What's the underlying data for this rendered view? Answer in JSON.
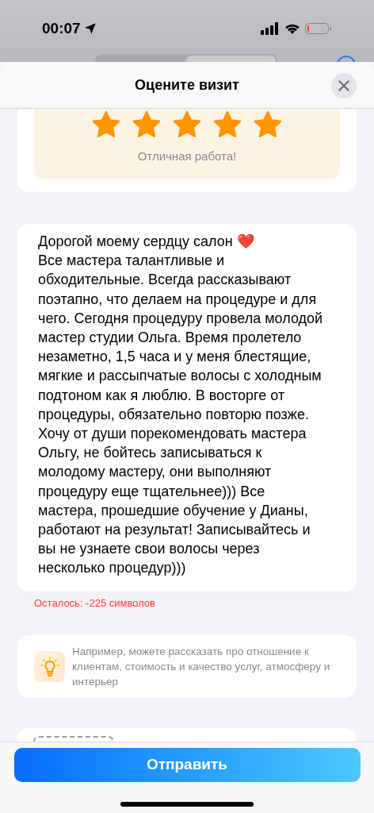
{
  "status_bar": {
    "time": "00:07"
  },
  "sheet": {
    "title": "Оцените визит"
  },
  "rating": {
    "stars": 5,
    "caption": "Отличная работа!"
  },
  "review": {
    "value": "Дорогой моему сердцу салон ❤️\nВсе мастера талантливые и обходительные. Всегда рассказывают поэтапно, что делаем на процедуре и для чего. Сегодня процедуру провела молодой мастер студии Ольга. Время пролетело незаметно, 1,5 часа и у меня блестящие, мягкие и рассыпчатые волосы с холодным подтоном как я люблю. В восторге от процедуры, обязательно повторю позже. Хочу от души порекомендовать  мастера Ольгу, не бойтесь записываться к молодому мастеру, они выполняют процедуру еще тщательнее))) Все мастера, прошедшие обучение у Дианы, работают на результат! Записывайтесь и вы не узнаете свои волосы через несколько процедур)))",
    "counter": "Осталось: -225 символов"
  },
  "hint": {
    "text": "Например, можете рассказать про отношение к клиентам, стоимость и качество услуг, атмосферу и интерьер"
  },
  "submit": {
    "label": "Отправить"
  }
}
